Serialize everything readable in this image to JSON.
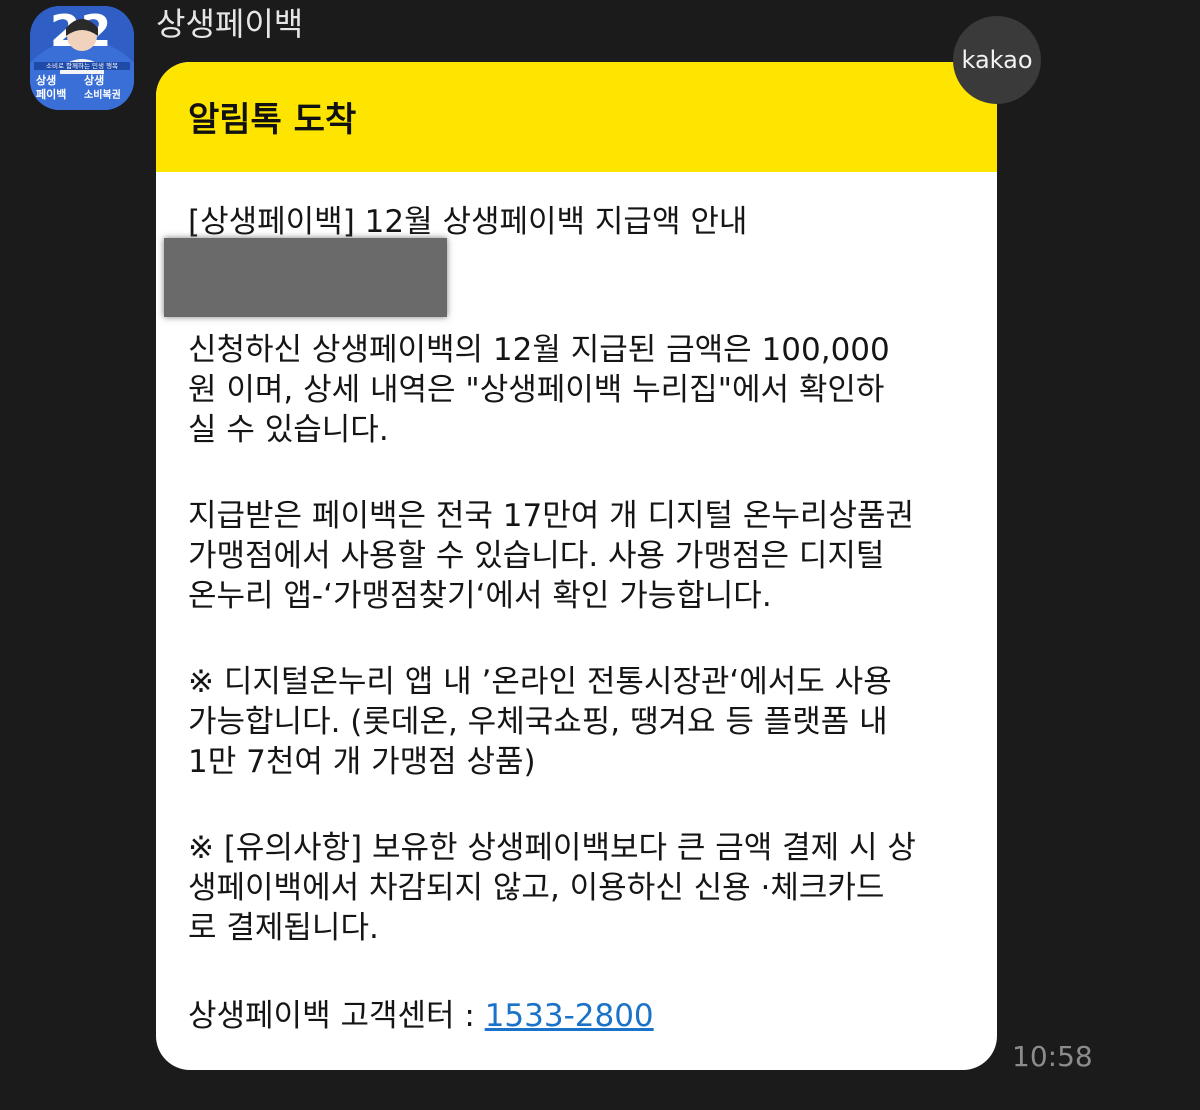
{
  "chat": {
    "sender_name": "상생페이백",
    "timestamp": "10:58"
  },
  "avatar": {
    "badge_number": "22",
    "top_caption": "소비로 함께하는 민생 행복",
    "logo_line1": "상생",
    "logo_line2": "페이백",
    "logo2_line1": "상생",
    "logo2_line2": "소비복권"
  },
  "kakao_badge": "kakao",
  "message": {
    "header_title": "알림톡 도착",
    "subject": "[상생페이백] 12월 상생페이백 지급액 안내",
    "para1": [
      "신청하신 상생페이백의 12월 지급된 금액은 100,000",
      "원 이며, 상세 내역은 \"상생페이백 누리집\"에서 확인하",
      "실 수 있습니다."
    ],
    "para2": [
      "지급받은 페이백은 전국 17만여 개 디지털 온누리상품권",
      " 가맹점에서 사용할 수 있습니다. 사용 가맹점은 디지털",
      "온누리 앱-‘가맹점찾기‘에서 확인 가능합니다."
    ],
    "para3": [
      "※ 디지털온누리 앱 내 ’온라인 전통시장관‘에서도 사용",
      "가능합니다. (롯데온, 우체국쇼핑, 땡겨요 등 플랫폼 내",
      "1만 7천여 개 가맹점 상품)"
    ],
    "para4": [
      "※ [유의사항] 보유한 상생페이백보다 큰 금액 결제 시 상",
      "생페이백에서 차감되지 않고, 이용하신 신용 ·체크카드",
      "로 결제됩니다."
    ],
    "contact_label": "상생페이백 고객센터 : ",
    "contact_phone": "1533-2800"
  },
  "colors": {
    "background": "#1b1b1b",
    "header_yellow": "#fde500",
    "link_blue": "#1a73c8"
  }
}
